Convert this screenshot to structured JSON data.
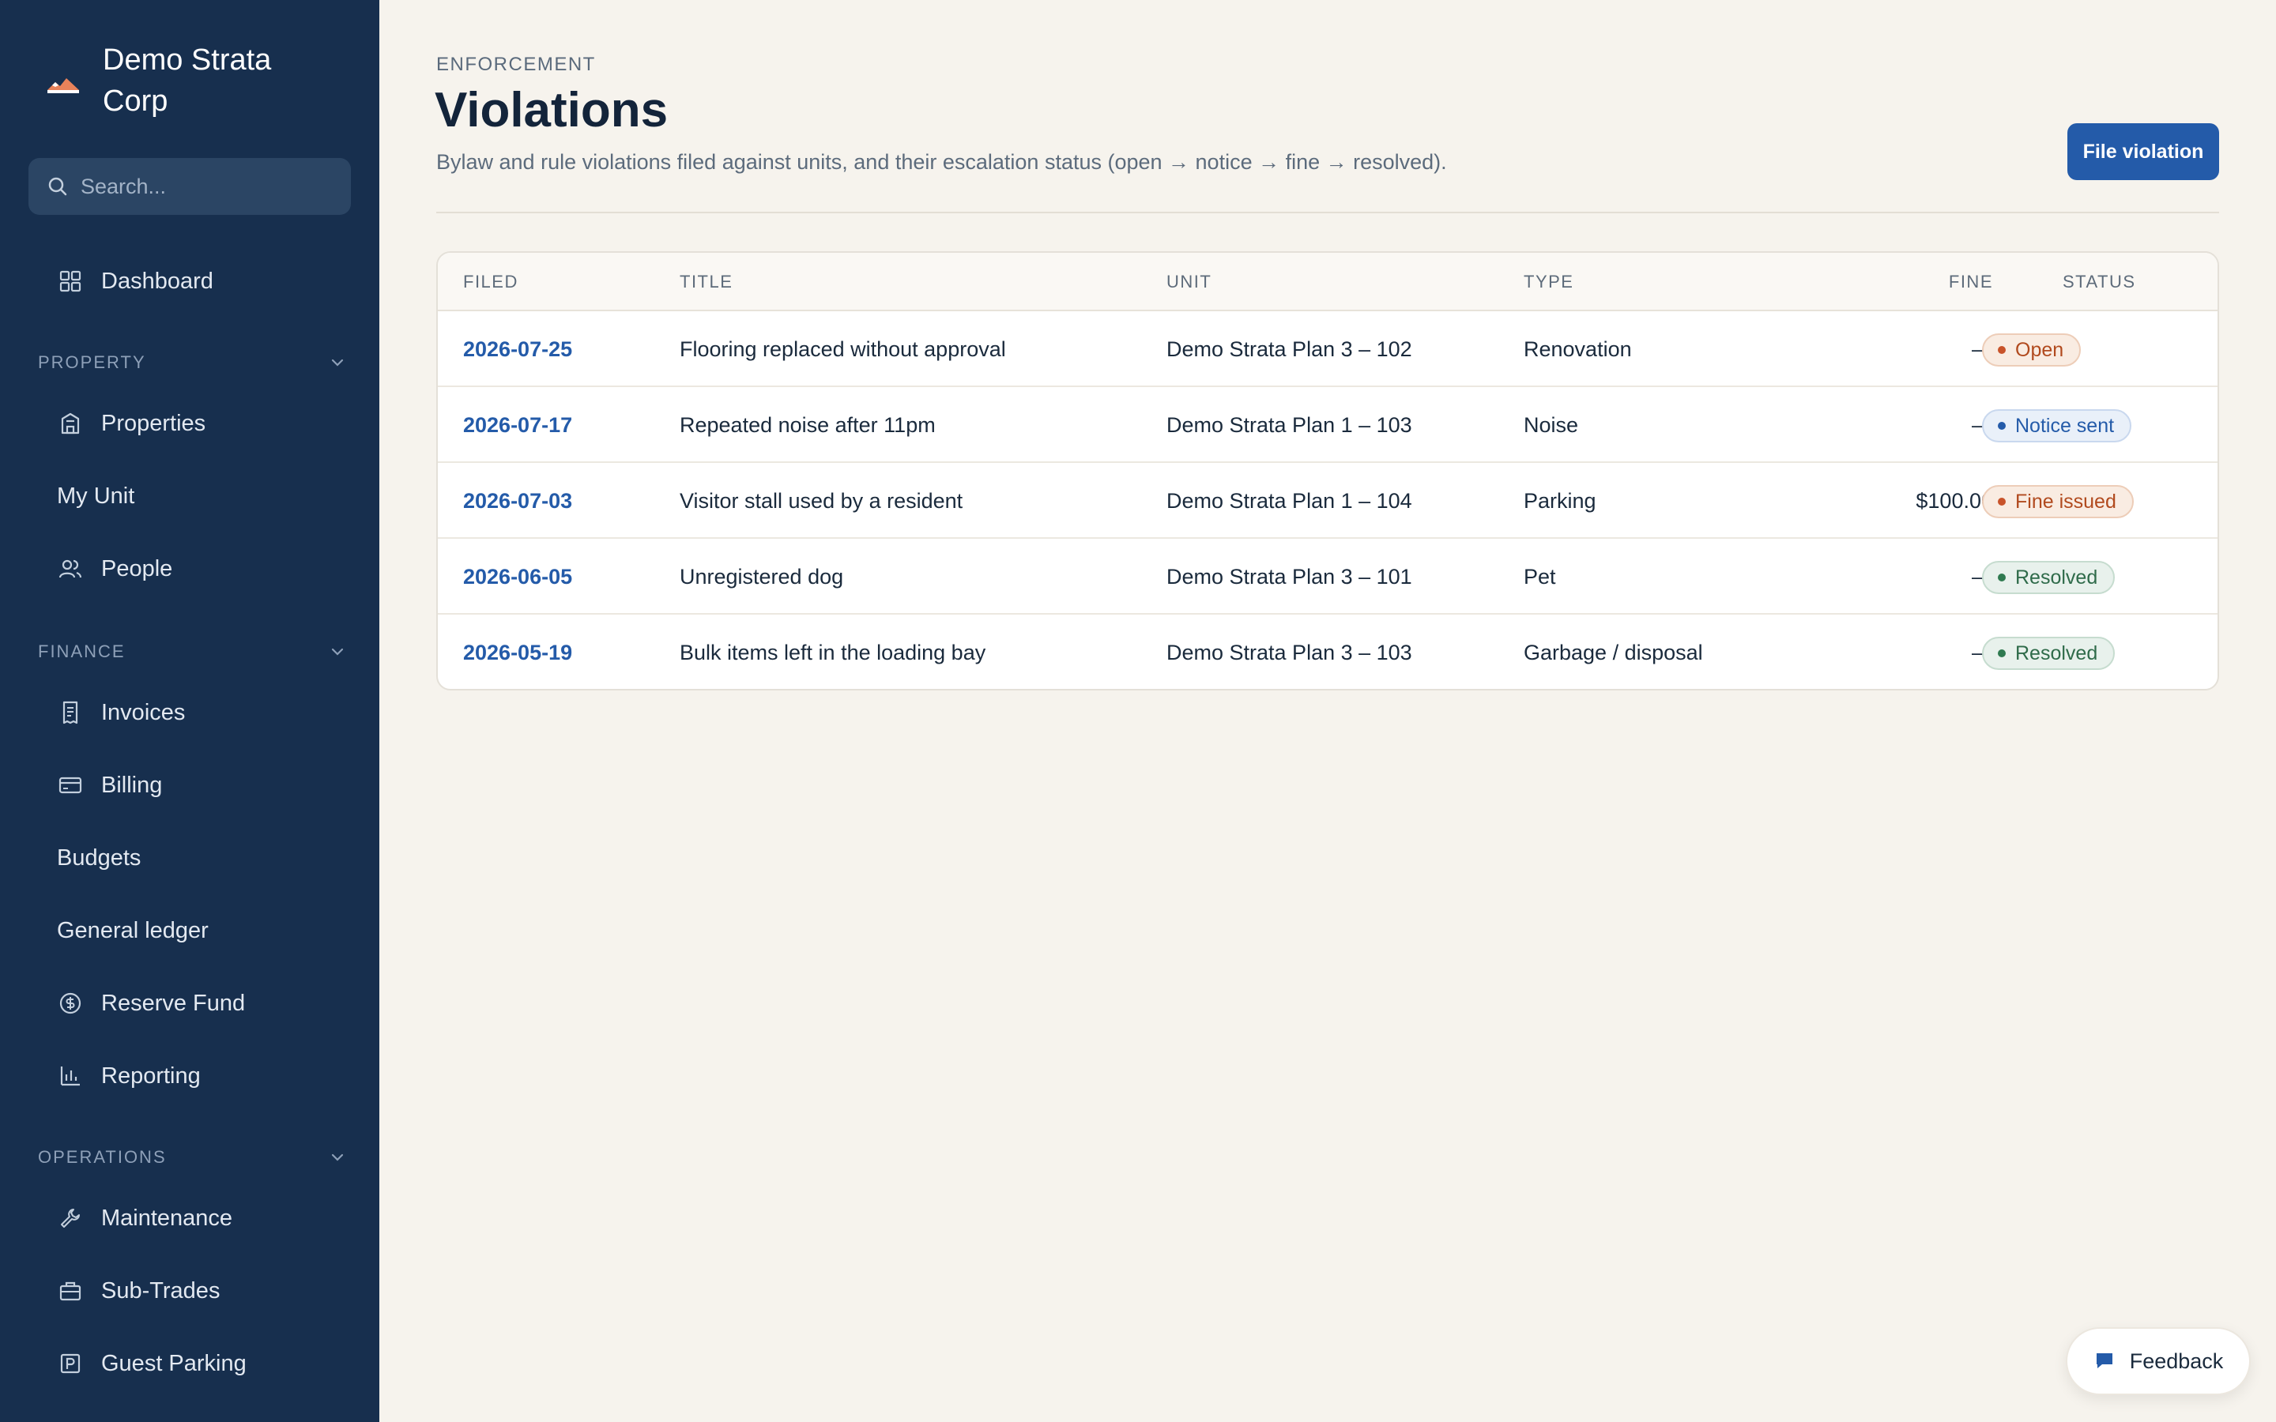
{
  "app": {
    "name": "Demo Strata Corp"
  },
  "search": {
    "placeholder": "Search..."
  },
  "nav": {
    "dashboard": "Dashboard",
    "sections": {
      "property": "PROPERTY",
      "finance": "FINANCE",
      "operations": "OPERATIONS"
    },
    "items": {
      "properties": "Properties",
      "my_unit": "My Unit",
      "people": "People",
      "invoices": "Invoices",
      "billing": "Billing",
      "budgets": "Budgets",
      "general_ledger": "General ledger",
      "reserve_fund": "Reserve Fund",
      "reporting": "Reporting",
      "maintenance": "Maintenance",
      "sub_trades": "Sub-Trades",
      "guest_parking": "Guest Parking"
    }
  },
  "page": {
    "eyebrow": "ENFORCEMENT",
    "title": "Violations",
    "subtitle": "Bylaw and rule violations filed against units, and their escalation status (open → notice → fine → resolved).",
    "primary_action": "File violation"
  },
  "table": {
    "headers": {
      "filed": "FILED",
      "title": "TITLE",
      "unit": "UNIT",
      "type": "TYPE",
      "fine": "FINE",
      "status": "STATUS"
    },
    "rows": [
      {
        "filed": "2026-07-25",
        "title": "Flooring replaced without approval",
        "unit": "Demo Strata Plan 3 – 102",
        "type": "Renovation",
        "fine": "—",
        "status": "Open"
      },
      {
        "filed": "2026-07-17",
        "title": "Repeated noise after 11pm",
        "unit": "Demo Strata Plan 1 – 103",
        "type": "Noise",
        "fine": "—",
        "status": "Notice sent"
      },
      {
        "filed": "2026-07-03",
        "title": "Visitor stall used by a resident",
        "unit": "Demo Strata Plan 1 – 104",
        "type": "Parking",
        "fine": "$100.00",
        "status": "Fine issued"
      },
      {
        "filed": "2026-06-05",
        "title": "Unregistered dog",
        "unit": "Demo Strata Plan 3 – 101",
        "type": "Pet",
        "fine": "—",
        "status": "Resolved"
      },
      {
        "filed": "2026-05-19",
        "title": "Bulk items left in the loading bay",
        "unit": "Demo Strata Plan 3 – 103",
        "type": "Garbage / disposal",
        "fine": "—",
        "status": "Resolved"
      }
    ]
  },
  "feedback": {
    "label": "Feedback"
  },
  "colors": {
    "sidebar": "#172f4e",
    "accent": "#245ba9",
    "background": "#f6f3ed",
    "status_open": "#c8532a",
    "status_notice": "#245ba9",
    "status_resolved": "#2f7a50"
  }
}
